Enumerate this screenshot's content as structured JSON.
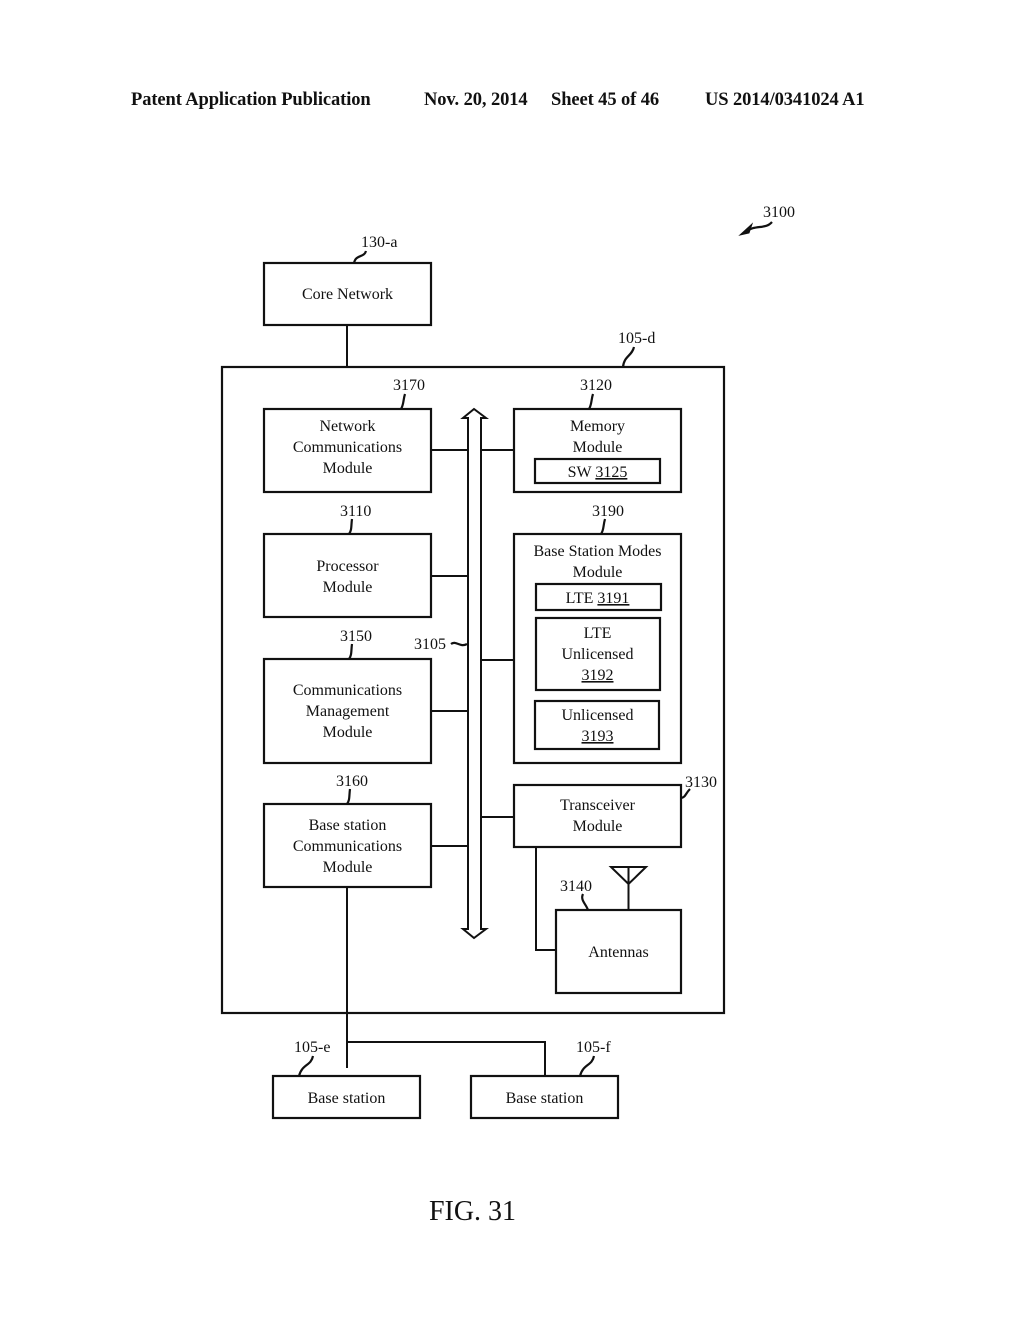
{
  "header": {
    "publication": "Patent Application Publication",
    "date": "Nov. 20, 2014",
    "sheet": "Sheet 45 of 46",
    "number": "US 2014/0341024 A1"
  },
  "figure": {
    "ref": "3100",
    "caption": "FIG. 31"
  },
  "core_network": {
    "ref": "130-a",
    "lines": [
      "Core Network"
    ]
  },
  "base_station_device": {
    "ref": "105-d"
  },
  "bus": {
    "ref": "3105"
  },
  "modules": {
    "network_comm": {
      "ref": "3170",
      "lines": [
        "Network",
        "Communications",
        "Module"
      ]
    },
    "processor": {
      "ref": "3110",
      "lines": [
        "Processor",
        "Module"
      ]
    },
    "comm_mgmt": {
      "ref": "3150",
      "lines": [
        "Communications",
        "Management",
        "Module"
      ]
    },
    "bs_comm": {
      "ref": "3160",
      "lines": [
        "Base station",
        "Communications",
        "Module"
      ]
    },
    "memory": {
      "ref": "3120",
      "lines": [
        "Memory",
        "Module"
      ],
      "sw_label": "SW ",
      "sw_ref": "3125"
    },
    "bs_modes": {
      "ref": "3190",
      "lines": [
        "Base Station Modes",
        "Module"
      ],
      "lte": {
        "label": "LTE ",
        "ref": "3191"
      },
      "lte_unlicensed": {
        "lines": [
          "LTE",
          "Unlicensed"
        ],
        "ref": "3192"
      },
      "unlicensed": {
        "lines": [
          "Unlicensed"
        ],
        "ref": "3193"
      }
    },
    "transceiver": {
      "ref": "3130",
      "lines": [
        "Transceiver",
        "Module"
      ]
    },
    "antennas": {
      "ref": "3140",
      "lines": [
        "Antennas"
      ]
    }
  },
  "base_stations": [
    {
      "ref": "105-e",
      "label": "Base station"
    },
    {
      "ref": "105-f",
      "label": "Base station"
    }
  ]
}
